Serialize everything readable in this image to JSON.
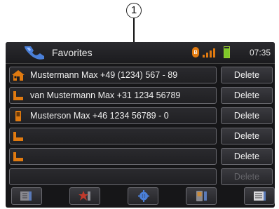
{
  "callout": {
    "label": "1"
  },
  "header": {
    "title": "Favorites",
    "bluetooth_symbol": "ʙ",
    "time": "07:35",
    "icons": [
      "phone-app-icon",
      "bluetooth-icon",
      "signal-strength-icon",
      "battery-icon"
    ]
  },
  "favorites": [
    {
      "name": "Mustermann Max +49 (1234) 567 - 89",
      "icon": "home-icon",
      "delete": "Delete",
      "delete_enabled": true
    },
    {
      "name": "van Mustermann Max +31 1234 56789",
      "icon": "landline-phone-icon",
      "delete": "Delete",
      "delete_enabled": true
    },
    {
      "name": "Musterson Max +46 1234 56789 - 0",
      "icon": "mobile-phone-icon",
      "delete": "Delete",
      "delete_enabled": true
    },
    {
      "name": "",
      "icon": "landline-phone-icon",
      "delete": "Delete",
      "delete_enabled": true
    },
    {
      "name": "",
      "icon": "landline-phone-icon",
      "delete": "Delete",
      "delete_enabled": true
    },
    {
      "name": "",
      "icon": "",
      "delete": "Delete",
      "delete_enabled": false
    }
  ],
  "toolbar": {
    "buttons": [
      "phonebook-icon",
      "favorites-star-icon",
      "settings-gear-icon",
      "mobile-device-icon",
      "call-list-icon"
    ]
  },
  "colors": {
    "accent_orange": "#e07a10",
    "battery_green": "#7ec82a",
    "screen_bg": "#161618"
  }
}
